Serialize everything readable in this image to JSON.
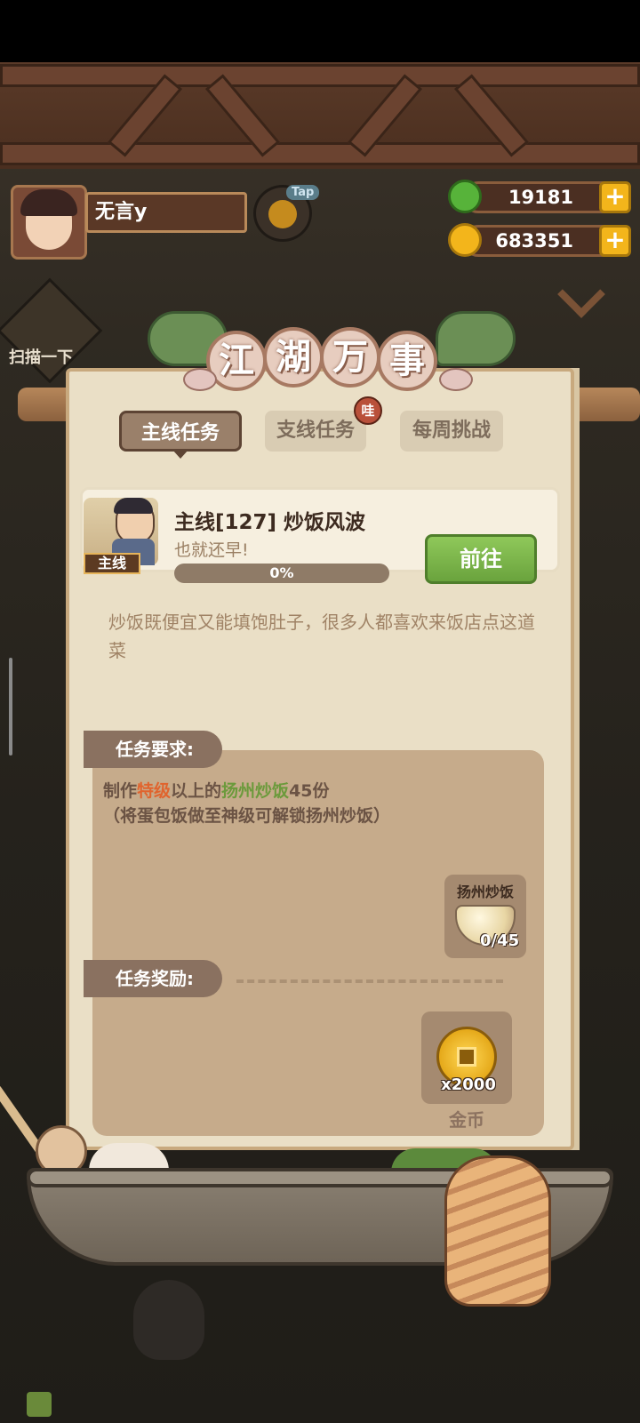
{
  "player": {
    "name": "无言y",
    "tap_tag": "Tap"
  },
  "resources": {
    "jade": {
      "value": "19181",
      "icon": "jade-icon",
      "color": "#57b33a"
    },
    "coins": {
      "value": "683351",
      "icon": "coin-icon",
      "color": "#f3b51b"
    }
  },
  "side_button": {
    "label": "扫描一下"
  },
  "panel": {
    "title_chars": [
      "江",
      "湖",
      "万",
      "事"
    ],
    "tabs": [
      {
        "label": "主线任务",
        "active": true
      },
      {
        "label": "支线任务",
        "active": false,
        "badge": "哇"
      },
      {
        "label": "每周挑战",
        "active": false
      }
    ],
    "quest": {
      "tag": "主线",
      "title": "主线[127]  炒饭风波",
      "subtitle": "也就还早!",
      "progress": 0,
      "progress_label": "0%",
      "go_button": "前往",
      "description": "炒饭既便宜又能填饱肚子，很多人都喜欢来饭店点这道菜"
    },
    "requirements": {
      "label": "任务要求:",
      "line1_prefix": "制作",
      "line1_grade": "特级",
      "line1_mid": "以上的",
      "line1_dish": "扬州炒饭",
      "line1_suffix": "45份",
      "line2": "（将蛋包饭做至神级可解锁扬州炒饭）",
      "item": {
        "name": "扬州炒饭",
        "count": "0/45",
        "icon": "fried-rice-icon"
      }
    },
    "rewards": {
      "label": "任务奖励:",
      "item": {
        "name": "金币",
        "amount": "x2000",
        "icon": "gold-coin-icon"
      }
    }
  },
  "colors": {
    "accent_green": "#6aa33d",
    "highlight_orange": "#e0642e",
    "highlight_green": "#6c9a3c",
    "panel": "#eadfc6"
  }
}
